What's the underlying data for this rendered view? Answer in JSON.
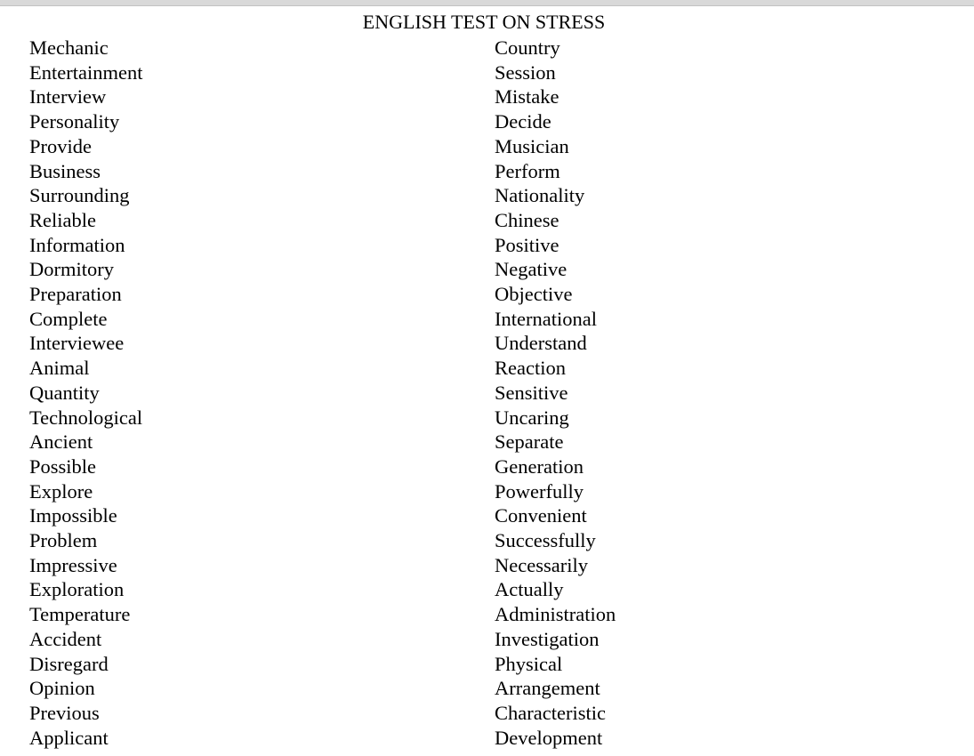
{
  "document": {
    "title": "ENGLISH TEST ON STRESS",
    "columns": [
      {
        "name": "left-column",
        "words": [
          "Mechanic",
          "Entertainment",
          "Interview",
          "Personality",
          "Provide",
          "Business",
          "Surrounding",
          "Reliable",
          "Information",
          "Dormitory",
          "Preparation",
          "Complete",
          "Interviewee",
          "Animal",
          "Quantity",
          "Technological",
          "Ancient",
          "Possible",
          "Explore",
          "Impossible",
          "Problem",
          "Impressive",
          "Exploration",
          "Temperature",
          "Accident",
          "Disregard",
          "Opinion",
          "Previous",
          "Applicant"
        ]
      },
      {
        "name": "right-column",
        "words": [
          "Country",
          "Session",
          "Mistake",
          "Decide",
          "Musician",
          "Perform",
          "Nationality",
          "Chinese",
          "Positive",
          "Negative",
          "Objective",
          "International",
          "Understand",
          "Reaction",
          "Sensitive",
          "Uncaring",
          "Separate",
          "Generation",
          "Powerfully",
          "Convenient",
          "Successfully",
          "Necessarily",
          "Actually",
          "Administration",
          "Investigation",
          "Physical",
          "Arrangement",
          "Characteristic",
          "Development"
        ]
      }
    ]
  },
  "colors": {
    "page_background": "#ffffff",
    "text": "#000000",
    "table_border": "#000000",
    "top_strip": "#d9d9d9"
  }
}
